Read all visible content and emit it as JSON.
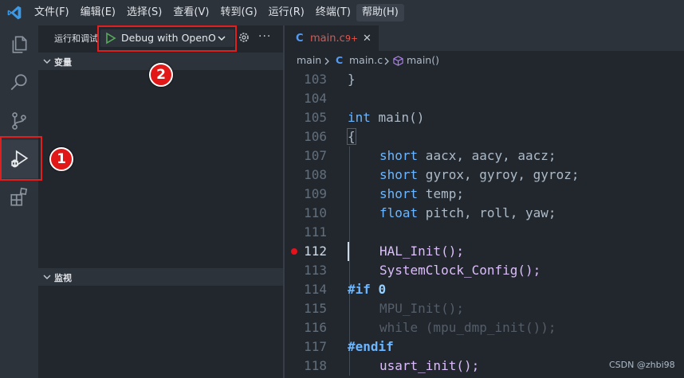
{
  "menu": [
    "文件(F)",
    "编辑(E)",
    "选择(S)",
    "查看(V)",
    "转到(G)",
    "运行(R)",
    "终端(T)",
    "帮助(H)"
  ],
  "sidebar": {
    "title": "运行和调试",
    "debug_config": "Debug with OpenOCD",
    "more": "···",
    "variables_label": "变量",
    "watch_label": "监视"
  },
  "annotations": {
    "one": "1",
    "two": "2"
  },
  "tab": {
    "lang": "C",
    "name": "main.c",
    "problems": "9+",
    "close": "✕"
  },
  "breadcrumb": {
    "folder": "main",
    "lang": "C",
    "file": "main.c",
    "symbol": "main()"
  },
  "code_lines": [
    {
      "n": "103",
      "text": "}"
    },
    {
      "n": "104",
      "text": ""
    },
    {
      "n": "105",
      "text": "int main()"
    },
    {
      "n": "106",
      "text": "{"
    },
    {
      "n": "107",
      "text": "short aacx, aacy, aacz;"
    },
    {
      "n": "108",
      "text": "short gyrox, gyroy, gyroz;"
    },
    {
      "n": "109",
      "text": "short temp;"
    },
    {
      "n": "110",
      "text": "float pitch, roll, yaw;"
    },
    {
      "n": "111",
      "text": ""
    },
    {
      "n": "112",
      "text": "HAL_Init();"
    },
    {
      "n": "113",
      "text": "SystemClock_Config();"
    },
    {
      "n": "114",
      "text": "#if 0"
    },
    {
      "n": "115",
      "text": "MPU_Init();"
    },
    {
      "n": "116",
      "text": "while (mpu_dmp_init());"
    },
    {
      "n": "117",
      "text": "#endif"
    },
    {
      "n": "118",
      "text": "usart_init();"
    }
  ],
  "watermark": "CSDN @zhbi98",
  "colors": {
    "accent": "#539bf5",
    "annotation_red": "#e02020",
    "breakpoint": "#e5121c"
  }
}
